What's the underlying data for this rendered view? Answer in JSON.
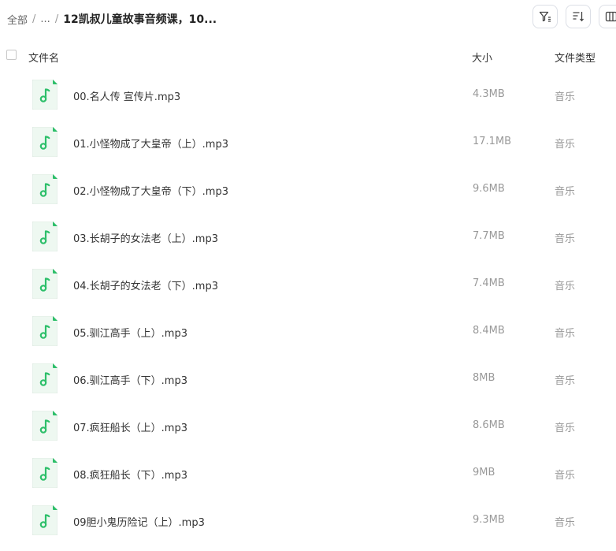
{
  "breadcrumb": {
    "root": "全部",
    "ellipsis": "...",
    "separator": "/",
    "current": "12凯叔儿童故事音频课，10..."
  },
  "header": {
    "name": "文件名",
    "size": "大小",
    "type": "文件类型"
  },
  "icons": {
    "file": "music-file-icon",
    "filter": "filter-icon",
    "sort": "sort-icon",
    "view": "column-view-icon"
  },
  "colors": {
    "accent": "#2dbf6a",
    "icon_bg": "#eef8f1"
  },
  "files": [
    {
      "name": "00.名人传 宣传片.mp3",
      "size": "4.3MB",
      "type": "音乐"
    },
    {
      "name": "01.小怪物成了大皇帝（上）.mp3",
      "size": "17.1MB",
      "type": "音乐"
    },
    {
      "name": "02.小怪物成了大皇帝（下）.mp3",
      "size": "9.6MB",
      "type": "音乐"
    },
    {
      "name": "03.长胡子的女法老（上）.mp3",
      "size": "7.7MB",
      "type": "音乐"
    },
    {
      "name": "04.长胡子的女法老（下）.mp3",
      "size": "7.4MB",
      "type": "音乐"
    },
    {
      "name": "05.驯江高手（上）.mp3",
      "size": "8.4MB",
      "type": "音乐"
    },
    {
      "name": "06.驯江高手（下）.mp3",
      "size": "8MB",
      "type": "音乐"
    },
    {
      "name": "07.疯狂船长（上）.mp3",
      "size": "8.6MB",
      "type": "音乐"
    },
    {
      "name": "08.疯狂船长（下）.mp3",
      "size": "9MB",
      "type": "音乐"
    },
    {
      "name": "09胆小鬼历险记（上）.mp3",
      "size": "9.3MB",
      "type": "音乐"
    }
  ]
}
